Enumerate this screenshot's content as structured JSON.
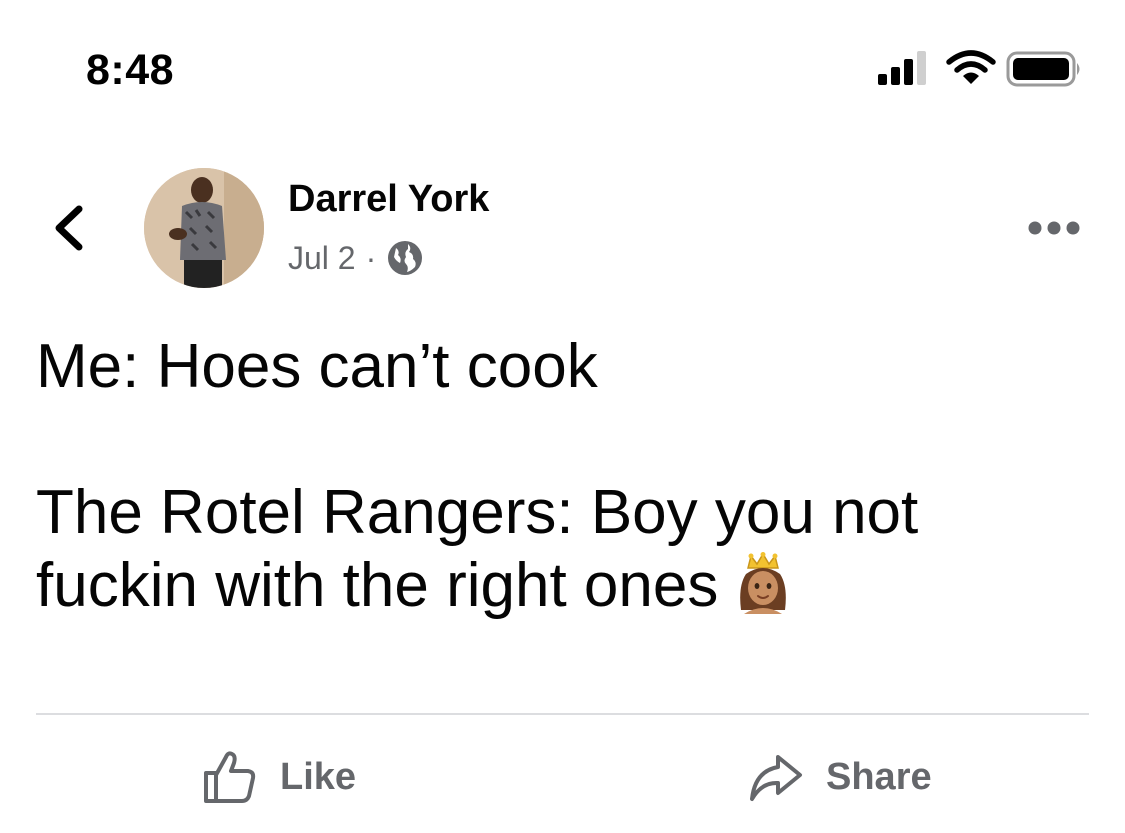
{
  "status_bar": {
    "time": "8:48",
    "icons": [
      "cellular-signal-icon",
      "wifi-icon",
      "battery-icon"
    ]
  },
  "post": {
    "author": "Darrel York",
    "date": "Jul 2",
    "separator": "·",
    "privacy_icon": "globe-icon",
    "text_lines": [
      "Me: Hoes can’t cook",
      "The Rotel Rangers: Boy you not",
      "fuckin with the right ones"
    ],
    "emoji": "princess-emoji"
  },
  "actions": {
    "like_label": "Like",
    "share_label": "Share"
  },
  "colors": {
    "text": "#050505",
    "secondary_text": "#65676b",
    "divider": "#dcdde0"
  }
}
